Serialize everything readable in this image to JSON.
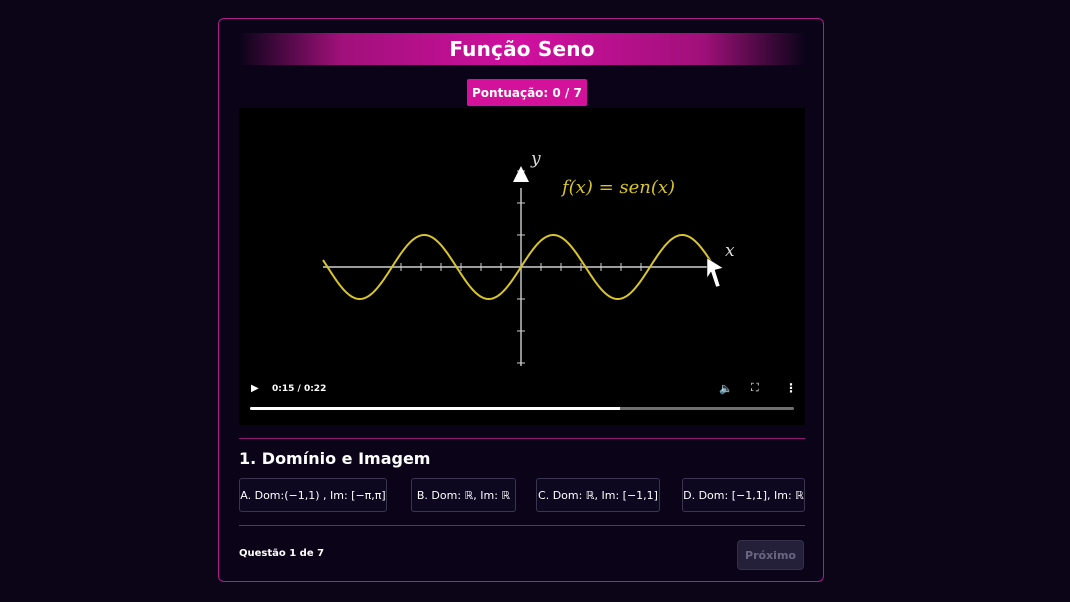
{
  "header": {
    "title": "Função Seno"
  },
  "score": {
    "label": "Pontuação: 0 / 7"
  },
  "video": {
    "graph": {
      "formula": "f(x) = sen(x)",
      "x_label": "x",
      "y_label": "y",
      "curve_color": "#d9c52a"
    },
    "controls": {
      "play_icon": "▶",
      "time": "0:15 / 0:22",
      "progress_fraction": 0.68,
      "volume_icon": "🔈",
      "fullscreen_icon": "⛶",
      "more_icon": "⋮"
    }
  },
  "question": {
    "title": "1. Domínio e Imagem",
    "options": [
      {
        "label": "A. Dom:(−1,1) , Im: [−π,π]"
      },
      {
        "label": "B. Dom: ℝ, Im: ℝ"
      },
      {
        "label": "C. Dom: ℝ, Im: [−1,1]"
      },
      {
        "label": "D. Dom: [−1,1], Im: ℝ"
      }
    ]
  },
  "footer": {
    "counter": "Questão 1 de 7",
    "next_label": "Próximo"
  },
  "colors": {
    "accent": "#d4119b",
    "border": "#b01a8c",
    "background": "#0c0518"
  }
}
